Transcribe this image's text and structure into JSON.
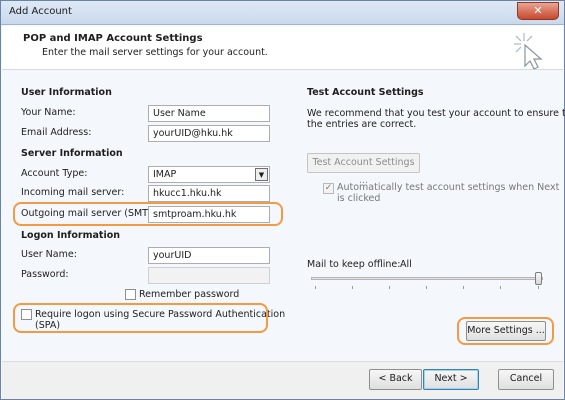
{
  "window": {
    "title": "Add Account",
    "close_label": "✕"
  },
  "header": {
    "title": "POP and IMAP Account Settings",
    "subtitle": "Enter the mail server settings for your account."
  },
  "user_info": {
    "section": "User Information",
    "name_label": "Your Name:",
    "name_value": "User Name",
    "email_label": "Email Address:",
    "email_value": "yourUID@hku.hk"
  },
  "server_info": {
    "section": "Server Information",
    "account_type_label": "Account Type:",
    "account_type_value": "IMAP",
    "incoming_label": "Incoming mail server:",
    "incoming_value": "hkucc1.hku.hk",
    "outgoing_label": "Outgoing mail server (SMTP):",
    "outgoing_value": "smtproam.hku.hk"
  },
  "logon_info": {
    "section": "Logon Information",
    "username_label": "User Name:",
    "username_value": "yourUID",
    "password_label": "Password:",
    "password_value": "",
    "remember_label": "Remember password",
    "spa_label_line1": "Require logon using Secure Password Authentication",
    "spa_label_line2": "(SPA)"
  },
  "test_settings": {
    "section": "Test Account Settings",
    "description_line1": "We recommend that you test your account to ensure that",
    "description_line2": "the entries are correct.",
    "test_button": "Test Account Settings ...",
    "auto_test_line1": "Automatically test account settings when Next",
    "auto_test_line2": "is clicked",
    "offline_label": "Mail to keep offline:",
    "offline_value": "All",
    "more_settings_button": "More Settings ..."
  },
  "footer": {
    "back_button": "< Back",
    "next_button": "Next >",
    "cancel_button": "Cancel"
  },
  "colors": {
    "highlight": "#f29a44",
    "title_bar": "#c9d9ec",
    "window_bg": "#f4f7fb"
  },
  "icons": {
    "wizard": "cursor-sparkle-icon",
    "close": "close-icon",
    "dropdown": "chevron-down-icon"
  }
}
